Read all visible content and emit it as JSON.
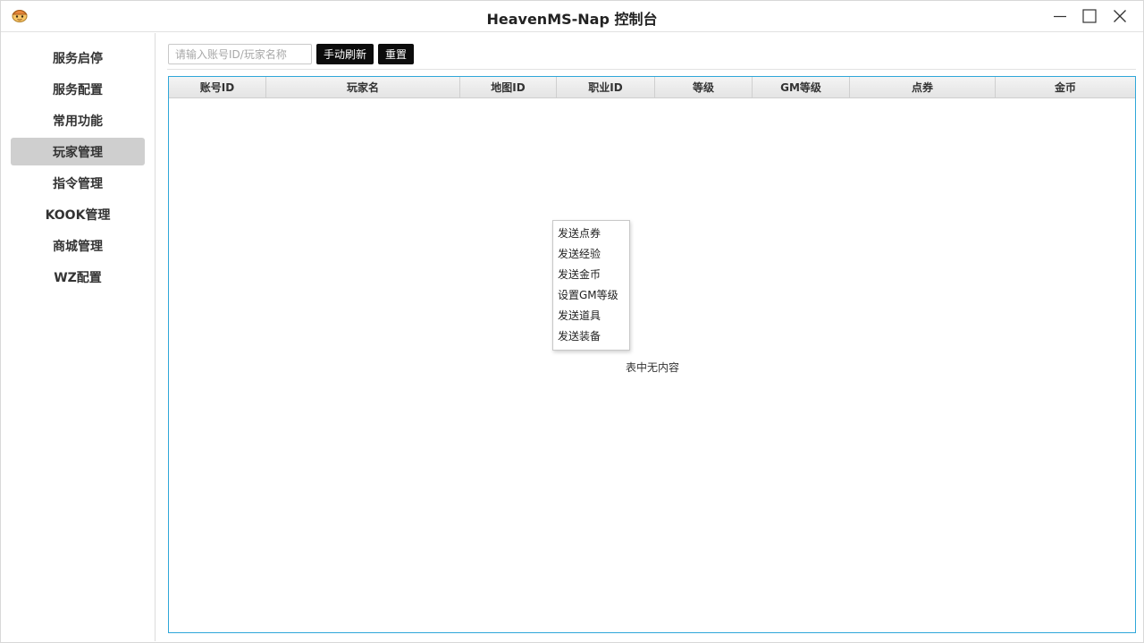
{
  "window": {
    "title": "HeavenMS-Nap 控制台",
    "icon": "app-mascot-icon",
    "controls": [
      "minimize-icon",
      "maximize-icon",
      "close-icon"
    ]
  },
  "sidebar": {
    "items": [
      {
        "label": "服务启停",
        "active": false
      },
      {
        "label": "服务配置",
        "active": false
      },
      {
        "label": "常用功能",
        "active": false
      },
      {
        "label": "玩家管理",
        "active": true
      },
      {
        "label": "指令管理",
        "active": false
      },
      {
        "label": "KOOK管理",
        "active": false
      },
      {
        "label": "商城管理",
        "active": false
      },
      {
        "label": "WZ配置",
        "active": false
      }
    ]
  },
  "toolbar": {
    "search_placeholder": "请输入账号ID/玩家名称",
    "search_value": "",
    "refresh_label": "手动刷新",
    "reset_label": "重置"
  },
  "table": {
    "columns": [
      "账号ID",
      "玩家名",
      "地图ID",
      "职业ID",
      "等级",
      "GM等级",
      "点券",
      "金币"
    ],
    "rows": [],
    "empty_text": "表中无内容"
  },
  "context_menu": {
    "items": [
      "发送点券",
      "发送经验",
      "发送金币",
      "设置GM等级",
      "发送道具",
      "发送装备"
    ]
  },
  "colors": {
    "active_nav": "#cfcfcf",
    "button_bg": "#0c0c0c",
    "table_border": "#2fa7d9"
  }
}
